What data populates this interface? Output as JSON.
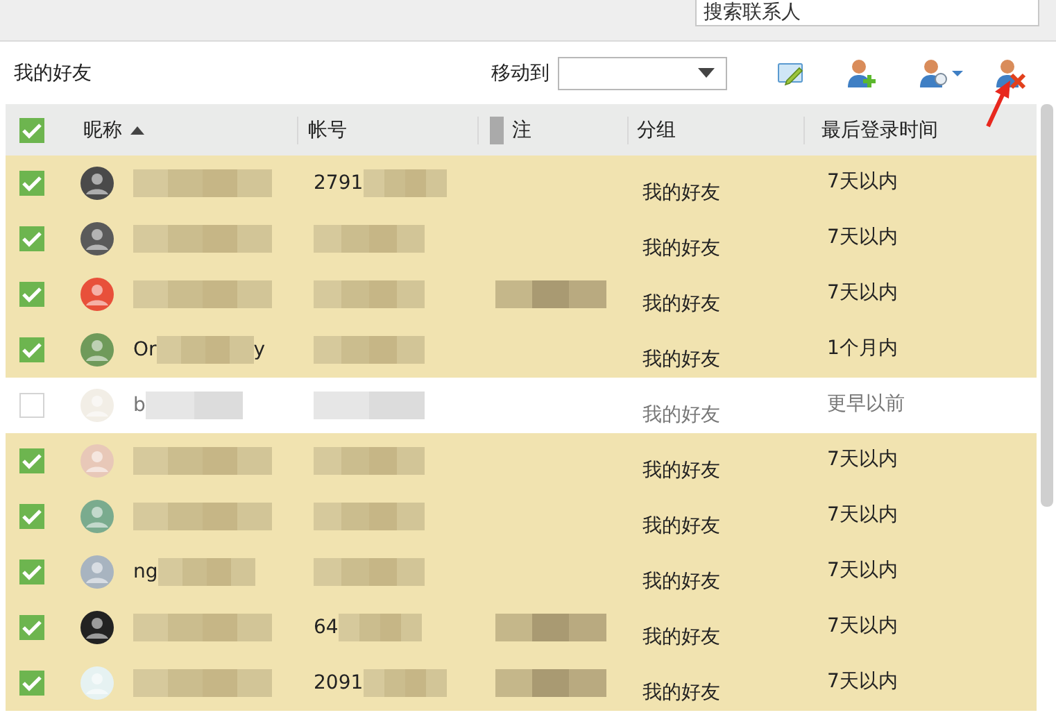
{
  "search": {
    "placeholder": "搜索联系人"
  },
  "toolbar": {
    "group_label": "我的好友",
    "move_label": "移动到"
  },
  "table": {
    "columns": [
      {
        "label": "昵称",
        "sorted": true
      },
      {
        "label": "帐号",
        "sorted": false
      },
      {
        "label": "注",
        "sorted": false
      },
      {
        "label": "分组",
        "sorted": false
      },
      {
        "label": "最后登录时间",
        "sorted": false
      }
    ],
    "all_checked": true,
    "rows": [
      {
        "checked": true,
        "nickname": [],
        "account": [
          "2791"
        ],
        "remark_redacted": false,
        "group": "我的好友",
        "last_login": "7天以内"
      },
      {
        "checked": true,
        "nickname": [],
        "account": [],
        "remark_redacted": false,
        "group": "我的好友",
        "last_login": "7天以内"
      },
      {
        "checked": true,
        "nickname": [],
        "account": [],
        "remark_redacted": true,
        "group": "我的好友",
        "last_login": "7天以内"
      },
      {
        "checked": true,
        "nickname": [
          "Or",
          "y"
        ],
        "account": [],
        "remark_redacted": false,
        "group": "我的好友",
        "last_login": "1个月内"
      },
      {
        "checked": false,
        "nickname": [
          "b"
        ],
        "account": [],
        "remark_redacted": false,
        "group": "我的好友",
        "last_login": "更早以前"
      },
      {
        "checked": true,
        "nickname": [],
        "account": [],
        "remark_redacted": false,
        "group": "我的好友",
        "last_login": "7天以内"
      },
      {
        "checked": true,
        "nickname": [],
        "account": [],
        "remark_redacted": false,
        "group": "我的好友",
        "last_login": "7天以内"
      },
      {
        "checked": true,
        "nickname": [
          "ng"
        ],
        "account": [],
        "remark_redacted": false,
        "group": "我的好友",
        "last_login": "7天以内"
      },
      {
        "checked": true,
        "nickname": [],
        "account": [
          "64"
        ],
        "remark_redacted": true,
        "group": "我的好友",
        "last_login": "7天以内"
      },
      {
        "checked": true,
        "nickname": [],
        "account": [
          "2091"
        ],
        "remark_redacted": true,
        "group": "我的好友",
        "last_login": "7天以内"
      }
    ]
  }
}
